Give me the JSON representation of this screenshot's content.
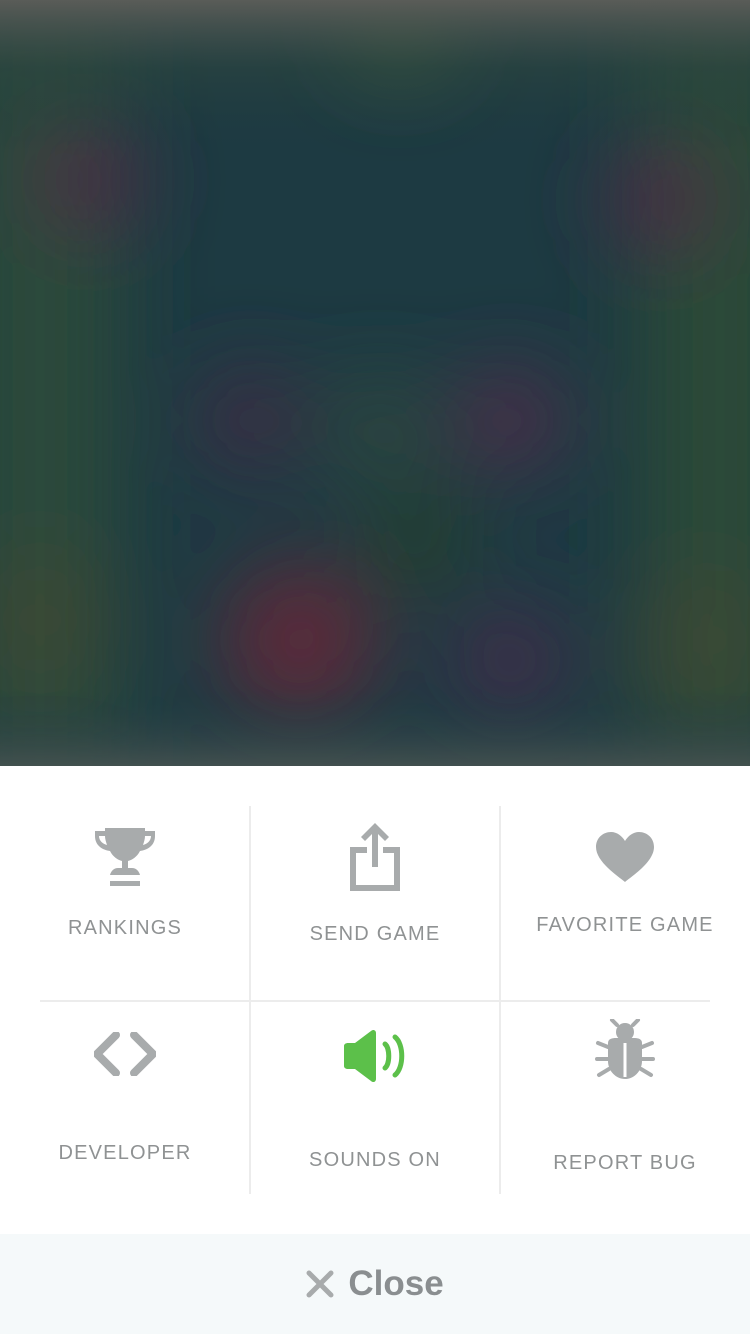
{
  "menu": {
    "items": [
      {
        "id": "rankings",
        "label": "RANKINGS",
        "icon": "trophy-icon"
      },
      {
        "id": "send-game",
        "label": "SEND GAME",
        "icon": "share-icon"
      },
      {
        "id": "favorite-game",
        "label": "FAVORITE GAME",
        "icon": "heart-icon"
      },
      {
        "id": "developer",
        "label": "DEVELOPER",
        "icon": "code-icon"
      },
      {
        "id": "sounds",
        "label": "SOUNDS ON",
        "icon": "speaker-icon",
        "state": "on"
      },
      {
        "id": "report-bug",
        "label": "REPORT BUG",
        "icon": "bug-icon"
      }
    ]
  },
  "close": {
    "label": "Close",
    "icon": "close-icon"
  },
  "colors": {
    "icon_gray": "#a8abac",
    "label_gray": "#8f9293",
    "sound_green": "#5cc04a",
    "close_bar_bg": "#f5f9fa"
  }
}
